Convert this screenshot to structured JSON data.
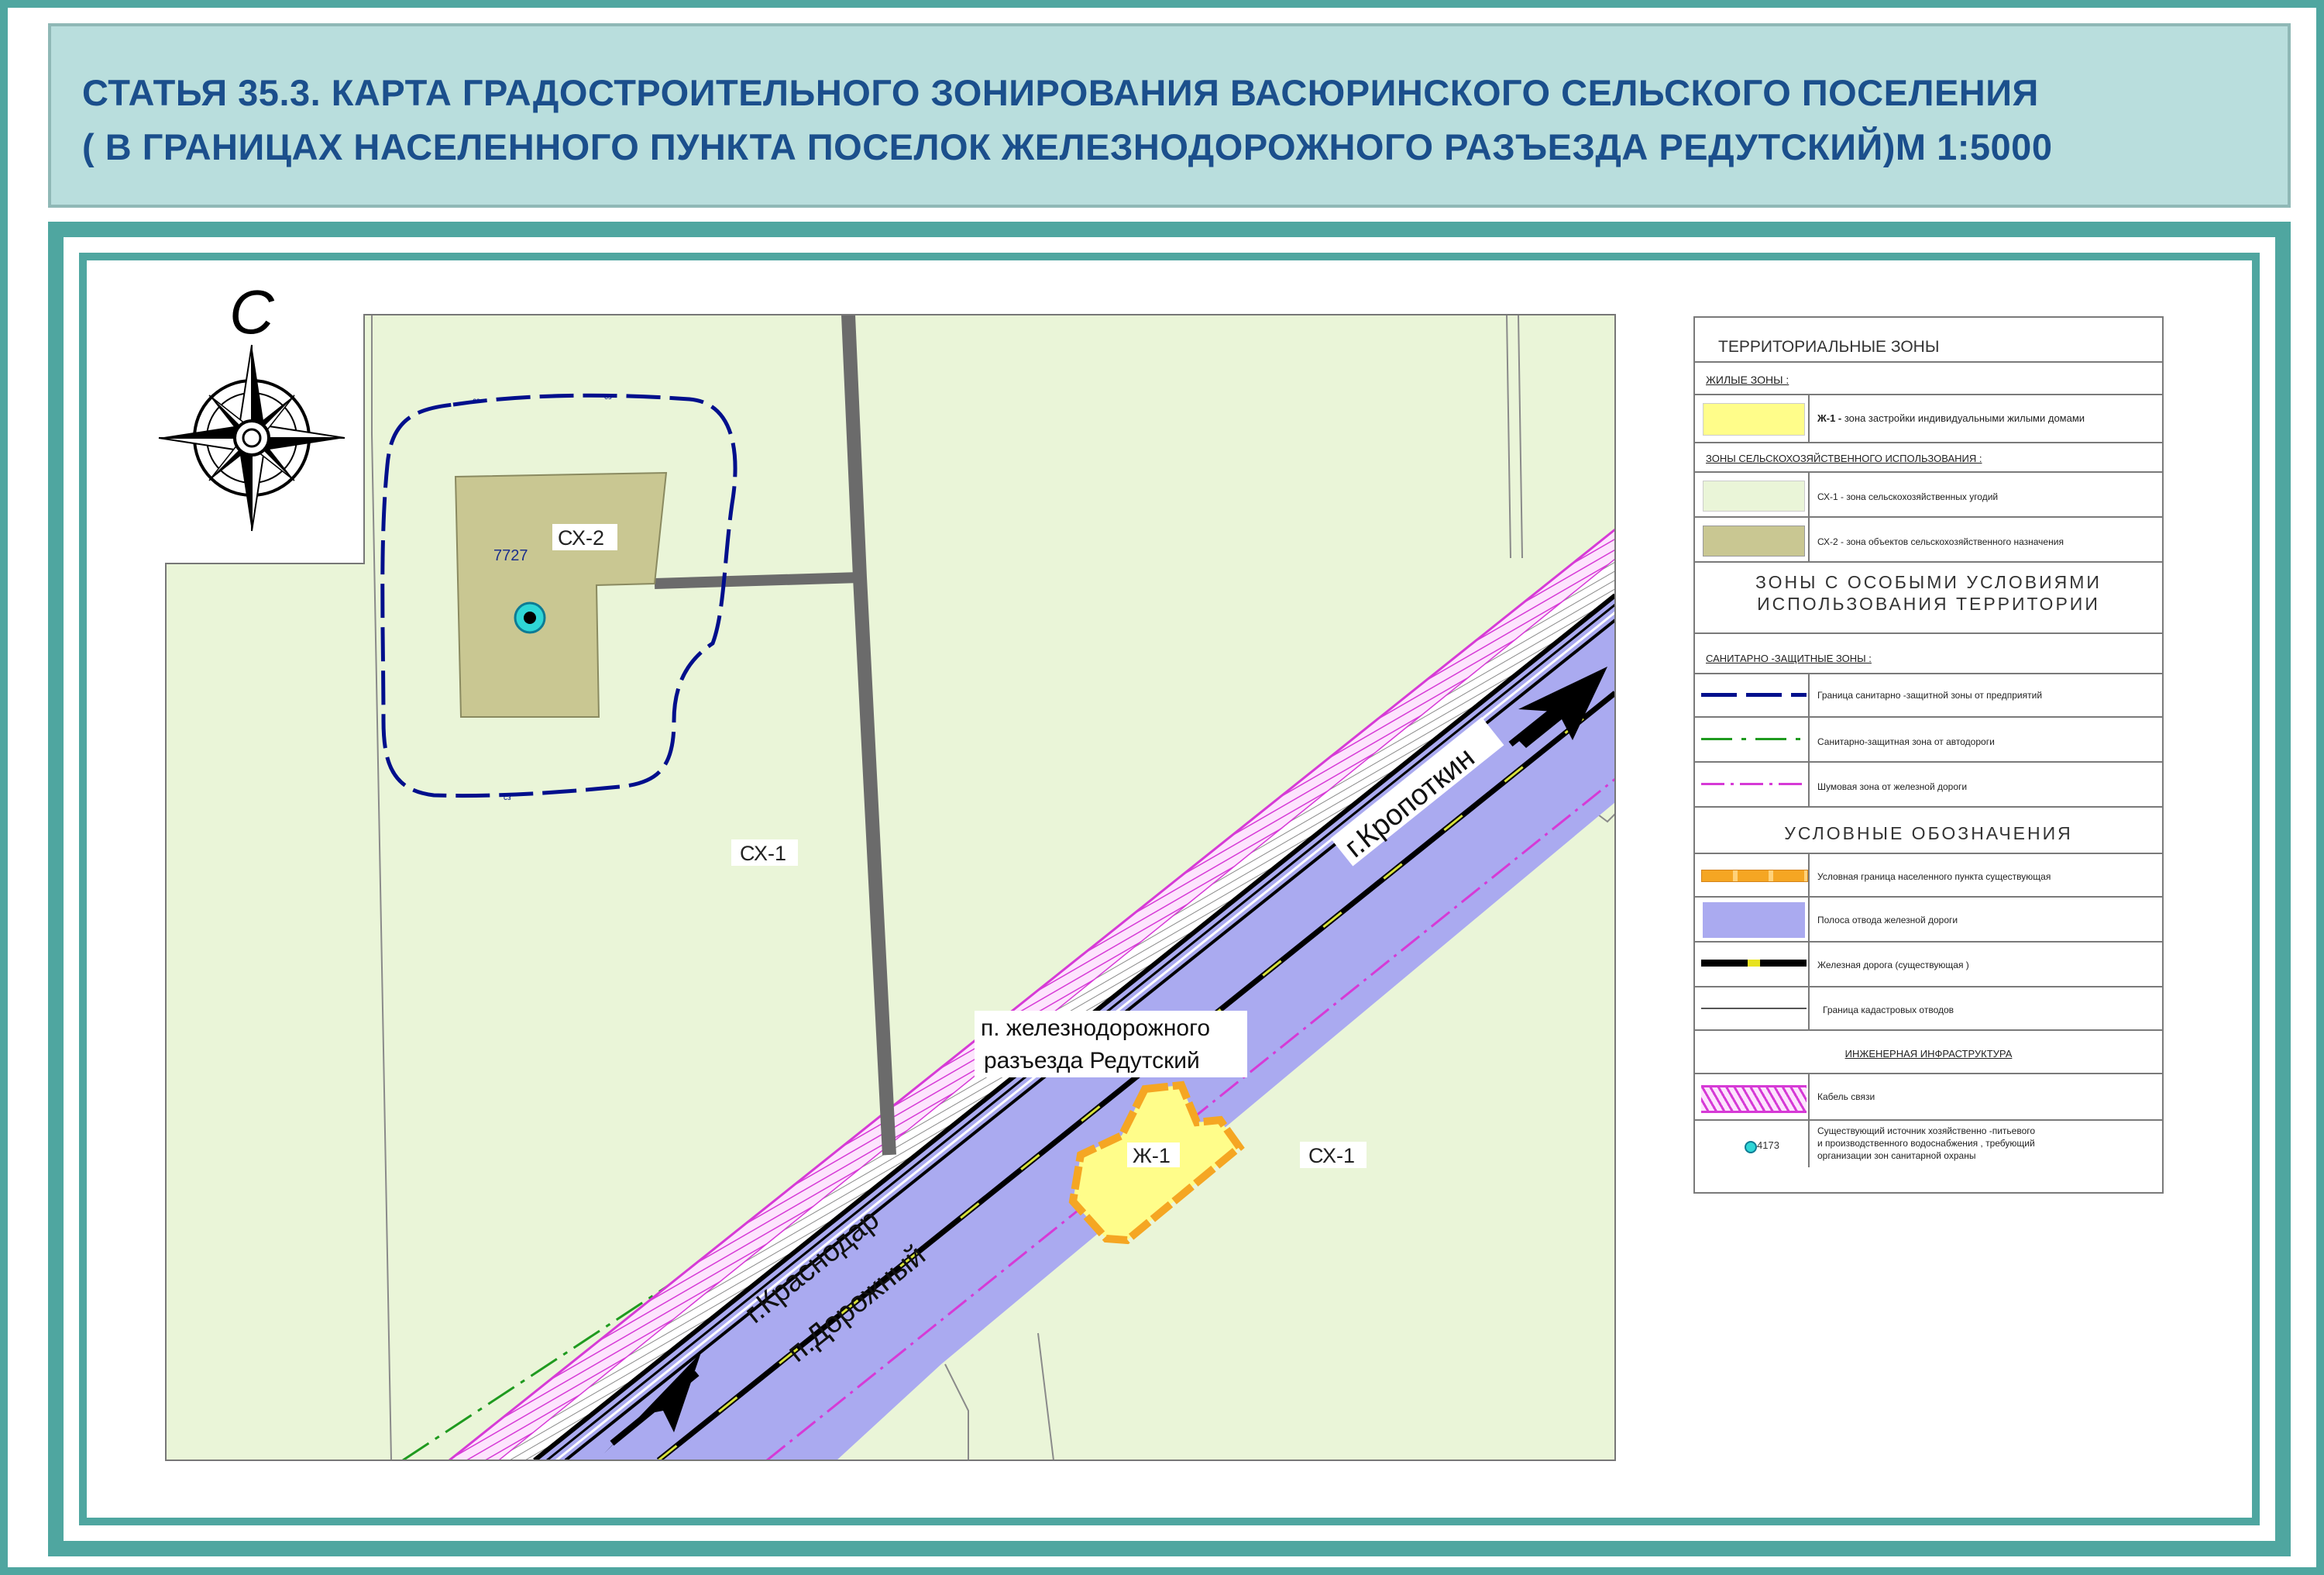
{
  "title": {
    "line1": "СТАТЬЯ 35.3. КАРТА ГРАДОСТРОИТЕЛЬНОГО ЗОНИРОВАНИЯ  ВАСЮРИНСКОГО СЕЛЬСКОГО ПОСЕЛЕНИЯ",
    "line2": "( В ГРАНИЦАХ НАСЕЛЕННОГО ПУНКТА  ПОСЕЛОК ЖЕЛЕЗНОДОРОЖНОГО РАЗЪЕЗДА РЕДУТСКИЙ)М 1:5000"
  },
  "compass": {
    "north_label": "С"
  },
  "map": {
    "zone_cx2_label": "СХ-2",
    "parcel_number": "7727",
    "zone_cx1_left": "СХ-1",
    "zone_cx1_right": "СХ-1",
    "zone_zh1": "Ж-1",
    "settlement_line1": "п. железнодорожного",
    "settlement_line2": "разъезда Редутский",
    "direction_up": "г.Кропоткин",
    "direction_down_1": "г.Краснодар",
    "direction_down_2": "п.Дорожный",
    "sz_marker": "сз"
  },
  "legend": {
    "territorial_zones": "ТЕРРИТОРИАЛЬНЫЕ ЗОНЫ",
    "residential_header": "ЖИЛЫЕ ЗОНЫ :",
    "zh1_label": "Ж-1 -",
    "zh1_text": " зона застройки индивидуальными жилыми домами",
    "agri_header": "ЗОНЫ СЕЛЬСКОХОЗЯЙСТВЕННОГО ИСПОЛЬЗОВАНИЯ   :",
    "cx1_text": "СХ-1 - зона сельскохозяйственных угодий",
    "cx2_text": "СХ-2 - зона объектов сельскохозяйственного назначения",
    "special_zones_1": "ЗОНЫ С ОСОБЫМИ УСЛОВИЯМИ",
    "special_zones_2": "ИСПОЛЬЗОВАНИЯ ТЕРРИТОРИИ",
    "sanitary_header": "САНИТАРНО -ЗАЩИТНЫЕ ЗОНЫ :",
    "sz_enterprise": "Граница санитарно -защитной зоны от предприятий",
    "sz_road": "Санитарно-защитная зона от автодороги",
    "noise_rail": "Шумовая зона от железной дороги",
    "symbols_header": "УСЛОВНЫЕ ОБОЗНАЧЕНИЯ",
    "settlement_border": "Условная граница населенного пункта существующая",
    "rail_strip": "Полоса отвода железной дороги",
    "railway": "Железная дорога  (существующая )",
    "cadastral": "Граница кадастровых отводов",
    "engineering_header": "ИНЖЕНЕРНАЯ ИНФРАСТРУКТУРА",
    "cable": "Кабель связи",
    "water_num": "4173",
    "water_line1": "Существующий источник хозяйственно  -питьевого",
    "water_line2": "  и производственного водоснабжения  , требующий",
    "water_line3": "организации зон санитарной охраны"
  },
  "colors": {
    "frame": "#4fa6a0",
    "title_bg": "#b9dedd",
    "title_text": "#1b4f8c",
    "agri_land": "#eaf5d8",
    "agri_buildings": "#c9c792",
    "rail_strip": "#aaaaf0",
    "residential": "#fffd8a",
    "settlement_border": "#f5a623",
    "sz_enterprise": "#000f8c",
    "sz_road": "#1f9a1f",
    "cable": "#d63ad6",
    "road": "#6b6b6b"
  }
}
